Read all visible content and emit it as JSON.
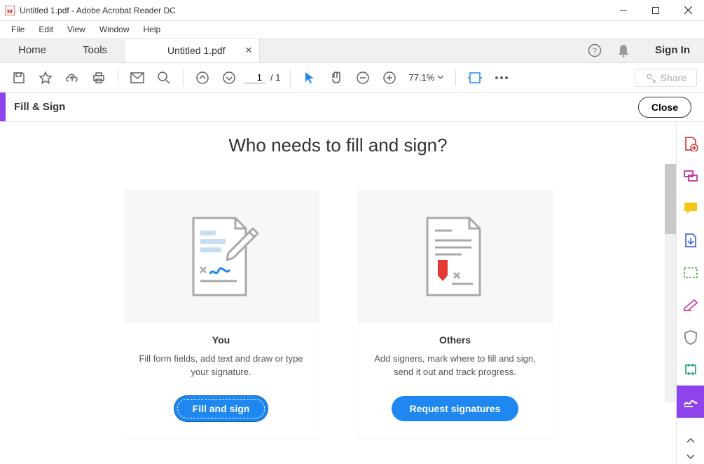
{
  "window": {
    "title": "Untitled 1.pdf - Adobe Acrobat Reader DC"
  },
  "menu": {
    "items": [
      "File",
      "Edit",
      "View",
      "Window",
      "Help"
    ]
  },
  "tabs": {
    "home": "Home",
    "tools": "Tools",
    "document": "Untitled 1.pdf",
    "signin": "Sign In"
  },
  "toolbar": {
    "page_current": "1",
    "page_total": "/ 1",
    "zoom": "77.1%",
    "share": "Share"
  },
  "fs_bar": {
    "label": "Fill & Sign",
    "close": "Close"
  },
  "main": {
    "heading": "Who needs to fill and sign?",
    "card_you": {
      "title": "You",
      "desc": "Fill form fields, add text and draw or type your signature.",
      "button": "Fill and sign"
    },
    "card_others": {
      "title": "Others",
      "desc": "Add signers, mark where to fill and sign, send it out and track progress.",
      "button": "Request signatures"
    }
  }
}
